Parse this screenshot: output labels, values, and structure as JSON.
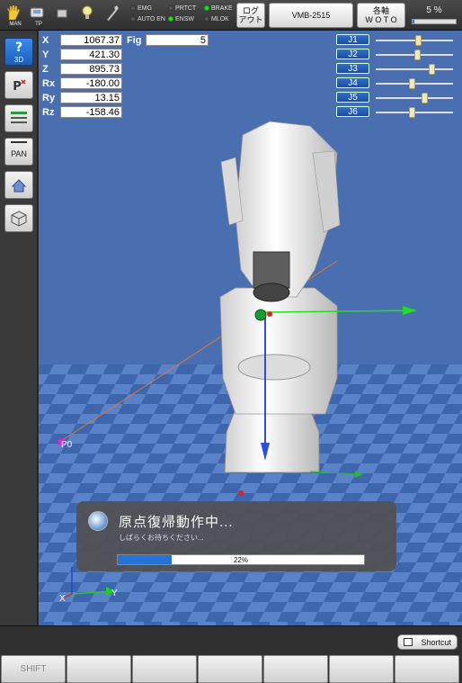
{
  "topbar": {
    "icons": [
      {
        "name": "man-hand-icon",
        "label": "MAN"
      },
      {
        "name": "teach-pendant-icon",
        "label": "TP"
      },
      {
        "name": "stop-square-icon",
        "label": ""
      },
      {
        "name": "light-bulb-icon",
        "label": ""
      },
      {
        "name": "wrench-icon",
        "label": ""
      }
    ],
    "lamps": [
      {
        "label": "EMG",
        "on": false
      },
      {
        "label": "PRTCT",
        "on": false
      },
      {
        "label": "BRAKE",
        "on": true
      },
      {
        "label": "AUTO EN",
        "on": false
      },
      {
        "label": "ENSW",
        "on": true
      },
      {
        "label": "MLOK",
        "on": false
      }
    ],
    "logout_line1": "ログ",
    "logout_line2": "アウト",
    "robot_model": "VMB-2515",
    "axis_line1": "各軸",
    "axis_line2": "W O T O",
    "speed_text": "5 %",
    "speed_percent": 5
  },
  "left_toolbar": {
    "view3d_label": "3D",
    "pan_label": "PAN"
  },
  "coords": {
    "X": {
      "label": "X",
      "value": "1067.37"
    },
    "Y": {
      "label": "Y",
      "value": "421.30"
    },
    "Z": {
      "label": "Z",
      "value": "895.73"
    },
    "Rx": {
      "label": "Rx",
      "value": "-180.00"
    },
    "Ry": {
      "label": "Ry",
      "value": "13.15"
    },
    "Rz": {
      "label": "Rz",
      "value": "-158.46"
    },
    "fig_label": "Fig",
    "fig_value": "5"
  },
  "joints": [
    {
      "label": "J1",
      "position": 0.55
    },
    {
      "label": "J2",
      "position": 0.53
    },
    {
      "label": "J3",
      "position": 0.72
    },
    {
      "label": "J4",
      "position": 0.47
    },
    {
      "label": "J5",
      "position": 0.63
    },
    {
      "label": "J6",
      "position": 0.47
    }
  ],
  "scene": {
    "point_label": "P0",
    "axis_x_label": "X",
    "axis_y_label": "Y"
  },
  "dialog": {
    "title": "原点復帰動作中...",
    "subtitle": "しばらくお待ちください...",
    "progress_text": "22%",
    "progress_percent": 22
  },
  "bottom": {
    "shortcut_label": "Shortcut",
    "fkeys": [
      "SHIFT",
      "",
      "",
      "",
      "",
      "",
      ""
    ]
  },
  "colors": {
    "floor_blue": "#5a82c8",
    "floor_dark": "#3e66ad",
    "sky": "#4a6fb0",
    "accent": "#1e7be0"
  }
}
